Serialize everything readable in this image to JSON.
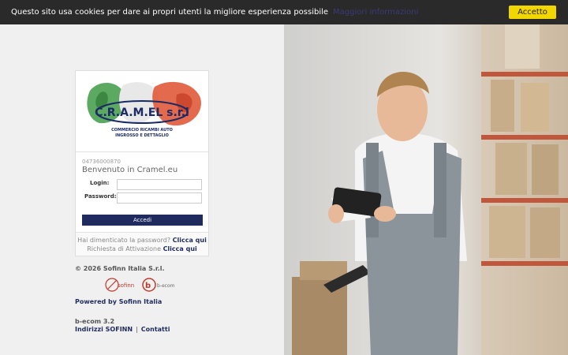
{
  "cookie_bar": {
    "text": "Questo sito usa cookies per dare ai propri utenti la migliore esperienza possibile",
    "more_link": "Maggiori informazioni",
    "accept_label": "Accetto",
    "accent": "#f1d600"
  },
  "login_card": {
    "logo_text": "C.R.A.M.EL s.r.l",
    "logo_subtitle_1": "COMMERCIO RICAMBI AUTO",
    "logo_subtitle_2": "INGROSSO E DETTAGLIO",
    "phone": "04736000870",
    "welcome": "Benvenuto in Cramel.eu",
    "login_label": "Login:",
    "password_label": "Password:",
    "login_value": "",
    "password_value": "",
    "submit_label": "Accedi",
    "forgot_text": "Hai dimenticato la password?",
    "forgot_link": "Clicca qui",
    "activation_text": "Richiesta di Attivazione",
    "activation_link": "Clicca qui"
  },
  "footer": {
    "copyright": "© 2026 Sofinn Italia S.r.l.",
    "partner_1": "sofinn",
    "partner_2": "b-ecom",
    "powered_by": "Powered by Sofinn Italia",
    "version": "b-ecom 3.2",
    "link_addresses": "Indirizzi SOFINN",
    "separator": "|",
    "link_contacts": "Contatti"
  },
  "colors": {
    "brand_navy": "#1f2b5e",
    "cookie_bg": "#2a2a2a"
  }
}
